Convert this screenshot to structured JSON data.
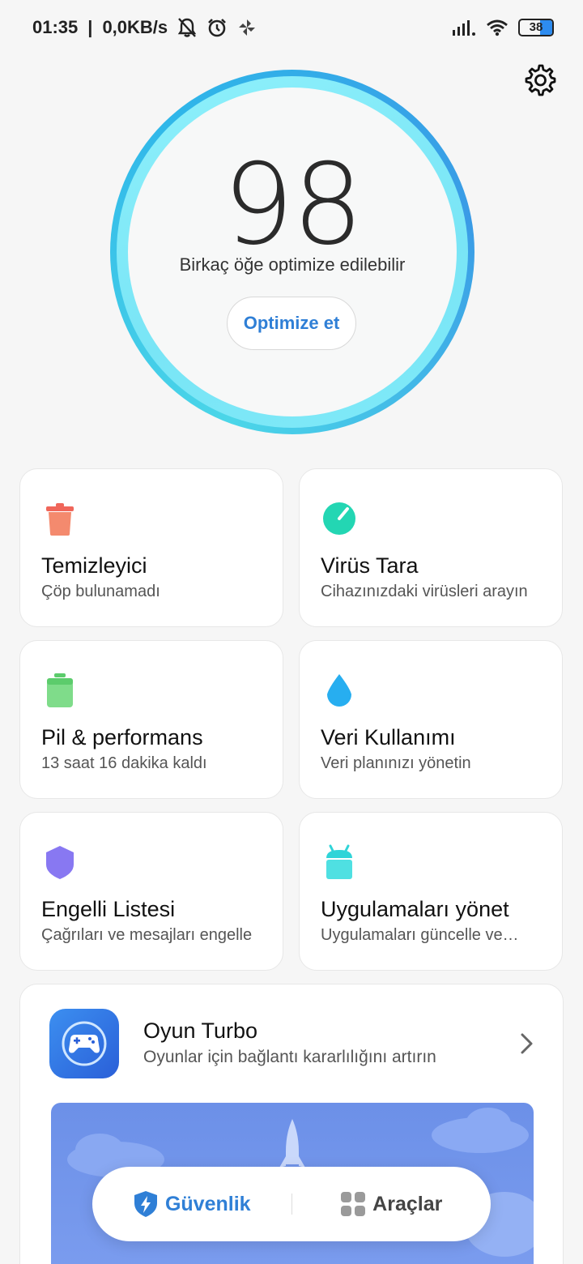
{
  "status_bar": {
    "time": "01:35",
    "speed": "0,0KB/s",
    "battery_level": "38",
    "battery_fill_percent": 38
  },
  "score": {
    "value": "98",
    "subtitle": "Birkaç öğe optimize edilebilir",
    "button_label": "Optimize et"
  },
  "cards": [
    {
      "title": "Temizleyici",
      "subtitle": "Çöp bulunamadı",
      "icon": "trash-icon",
      "color": "#f0665a"
    },
    {
      "title": "Virüs Tara",
      "subtitle": "Cihazınızdaki virüsleri arayın",
      "icon": "virus-scan-icon",
      "color": "#23d6b3"
    },
    {
      "title": "Pil & performans",
      "subtitle": "13 saat 16 dakika  kaldı",
      "icon": "battery-icon",
      "color": "#5ccc6c"
    },
    {
      "title": "Veri Kullanımı",
      "subtitle": "Veri planınızı yönetin",
      "icon": "water-drop-icon",
      "color": "#27aef0"
    },
    {
      "title": "Engelli Listesi",
      "subtitle": "Çağrıları ve mesajları engelle",
      "icon": "shield-icon",
      "color": "#7d6ff0"
    },
    {
      "title": "Uygulamaları yönet",
      "subtitle": "Uygulamaları güncelle ve…",
      "icon": "android-icon",
      "color": "#2fd4d8"
    }
  ],
  "game_turbo": {
    "title": "Oyun Turbo",
    "subtitle": "Oyunlar için bağlantı kararlılığını artırın",
    "icon": "gamepad-icon"
  },
  "bottom_nav": {
    "security_label": "Güvenlik",
    "tools_label": "Araçlar",
    "active_color": "#2f7fd6"
  }
}
